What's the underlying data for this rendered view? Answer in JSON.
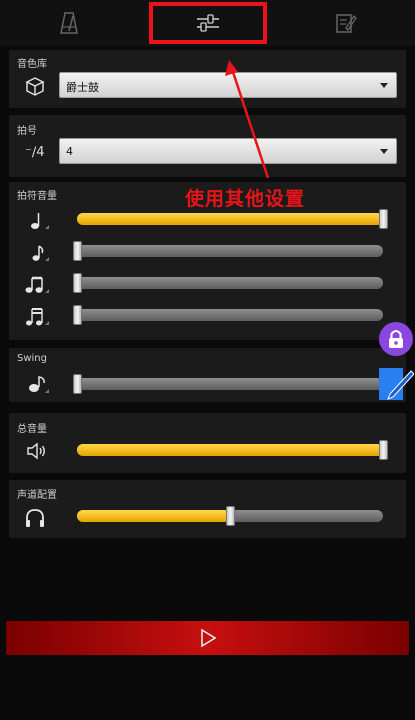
{
  "tabs": [
    {
      "name": "metronome",
      "icon": "metronome-icon"
    },
    {
      "name": "settings",
      "icon": "sliders-icon",
      "selected": true
    },
    {
      "name": "notes",
      "icon": "edit-icon"
    }
  ],
  "timbre": {
    "label": "音色库",
    "value": "爵士鼓",
    "icon": "drum-icon"
  },
  "time_signature": {
    "label": "拍号",
    "value": "4",
    "icon": "time-signature-icon",
    "symbol": "⁻∕4"
  },
  "note_volume": {
    "label": "拍符音量",
    "rows": [
      {
        "icon": "quarter-note-icon",
        "level": 1.0
      },
      {
        "icon": "eighth-note-icon",
        "level": 0.0
      },
      {
        "icon": "double-eighth-icon",
        "level": 0.0
      },
      {
        "icon": "sixteenth-icon",
        "level": 0.0
      }
    ]
  },
  "swing": {
    "label": "Swing",
    "icon": "swing-icon",
    "level": 0.0
  },
  "master_volume": {
    "label": "总音量",
    "icon": "speaker-icon",
    "level": 1.0
  },
  "channel": {
    "label": "声道配置",
    "icon": "headphones-icon",
    "level": 0.5
  },
  "annotation": "使用其他设置",
  "play": {
    "icon": "play-icon"
  },
  "colors": {
    "accent_yellow": "#f0b800",
    "highlight_red": "#e8141a",
    "play_red": "#c70f0f"
  }
}
